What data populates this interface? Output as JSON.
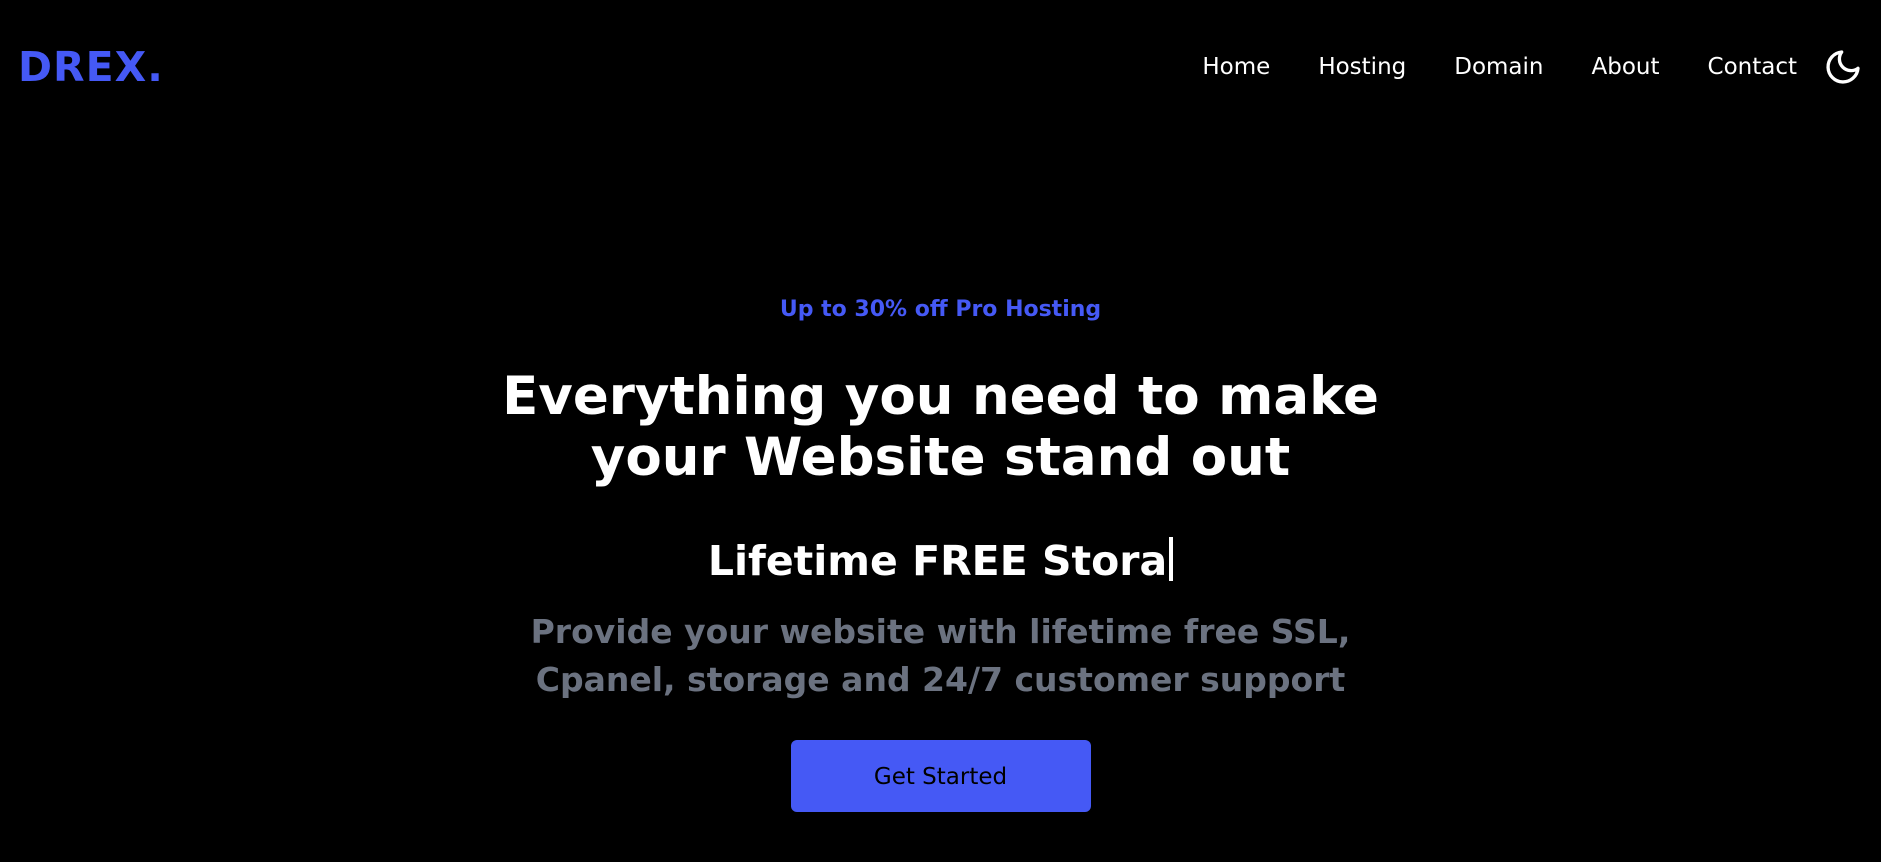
{
  "nav": {
    "logo": "DREX.",
    "links": [
      {
        "label": "Home"
      },
      {
        "label": "Hosting"
      },
      {
        "label": "Domain"
      },
      {
        "label": "About"
      },
      {
        "label": "Contact"
      }
    ],
    "theme_toggle_icon": "moon-icon"
  },
  "hero": {
    "promo": "Up to 30% off Pro Hosting",
    "headline": "Everything you need to make your Website stand out",
    "typed_text": "Lifetime FREE Stora",
    "subtext": "Provide your website with lifetime free SSL, Cpanel, storage and 24/7 customer support",
    "cta_label": "Get Started"
  },
  "colors": {
    "background": "#000000",
    "accent": "#4559f5",
    "text": "#ffffff",
    "muted": "#6b7280"
  }
}
